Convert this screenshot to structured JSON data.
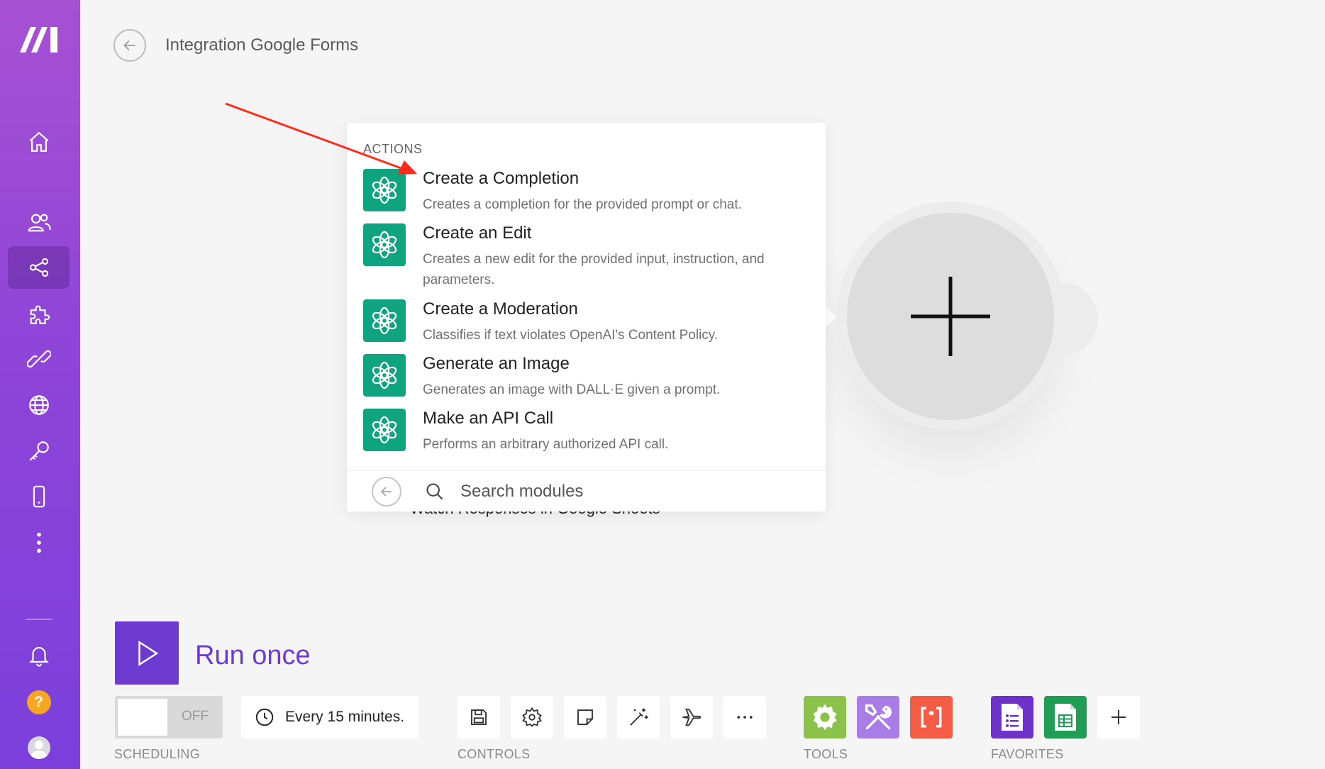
{
  "header": {
    "title": "Integration Google Forms"
  },
  "sidebar": {
    "items": [
      {
        "icon": "home-icon"
      },
      {
        "icon": "team-icon"
      },
      {
        "icon": "scenarios-share-icon",
        "active": true
      },
      {
        "icon": "templates-puzzle-icon"
      },
      {
        "icon": "connections-link-icon"
      },
      {
        "icon": "webhooks-globe-icon"
      },
      {
        "icon": "keys-icon"
      },
      {
        "icon": "devices-phone-icon"
      },
      {
        "icon": "more-vertical-icon"
      },
      {
        "icon": "notifications-bell-icon"
      },
      {
        "icon": "help-icon",
        "label": "?"
      },
      {
        "icon": "avatar-icon"
      }
    ]
  },
  "popover": {
    "heading": "ACTIONS",
    "actions": [
      {
        "title": "Create a Completion",
        "desc": "Creates a completion for the provided prompt or chat."
      },
      {
        "title": "Create an Edit",
        "desc": "Creates a new edit for the provided input, instruction, and parameters."
      },
      {
        "title": "Create a Moderation",
        "desc": "Classifies if text violates OpenAI's Content Policy."
      },
      {
        "title": "Generate an Image",
        "desc": "Generates an image with DALL·E given a prompt."
      },
      {
        "title": "Make an API Call",
        "desc": "Performs an arbitrary authorized API call."
      }
    ],
    "search_placeholder": "Search modules"
  },
  "canvas": {
    "under_text": "Watch Responses in Google Sheets"
  },
  "toolbar": {
    "run_label": "Run once",
    "scheduling_toggle": "OFF",
    "schedule_interval": "Every 15 minutes.",
    "sections": {
      "scheduling": "SCHEDULING",
      "controls": "CONTROLS",
      "tools": "TOOLS",
      "favorites": "FAVORITES"
    },
    "controls": [
      "save-icon",
      "settings-gear-icon",
      "notes-icon",
      "auto-align-wand-icon",
      "explain-flow-plane-icon",
      "more-horizontal-icon"
    ],
    "tools": [
      {
        "icon": "flow-control-gear-icon",
        "color": "#8bc34a"
      },
      {
        "icon": "tools-wrench-icon",
        "color": "#a97de8"
      },
      {
        "icon": "text-parser-icon",
        "color": "#f45c45"
      }
    ],
    "favorites": [
      {
        "icon": "google-forms-icon",
        "color": "#6f32c9"
      },
      {
        "icon": "google-sheets-icon",
        "color": "#1f9d55"
      },
      {
        "icon": "add-favorite-plus-icon",
        "color": "#ffffff"
      }
    ]
  },
  "colors": {
    "brand_purple": "#6d3bd0",
    "openai_green": "#10a37f",
    "annotation_red": "#ff2a1a"
  }
}
